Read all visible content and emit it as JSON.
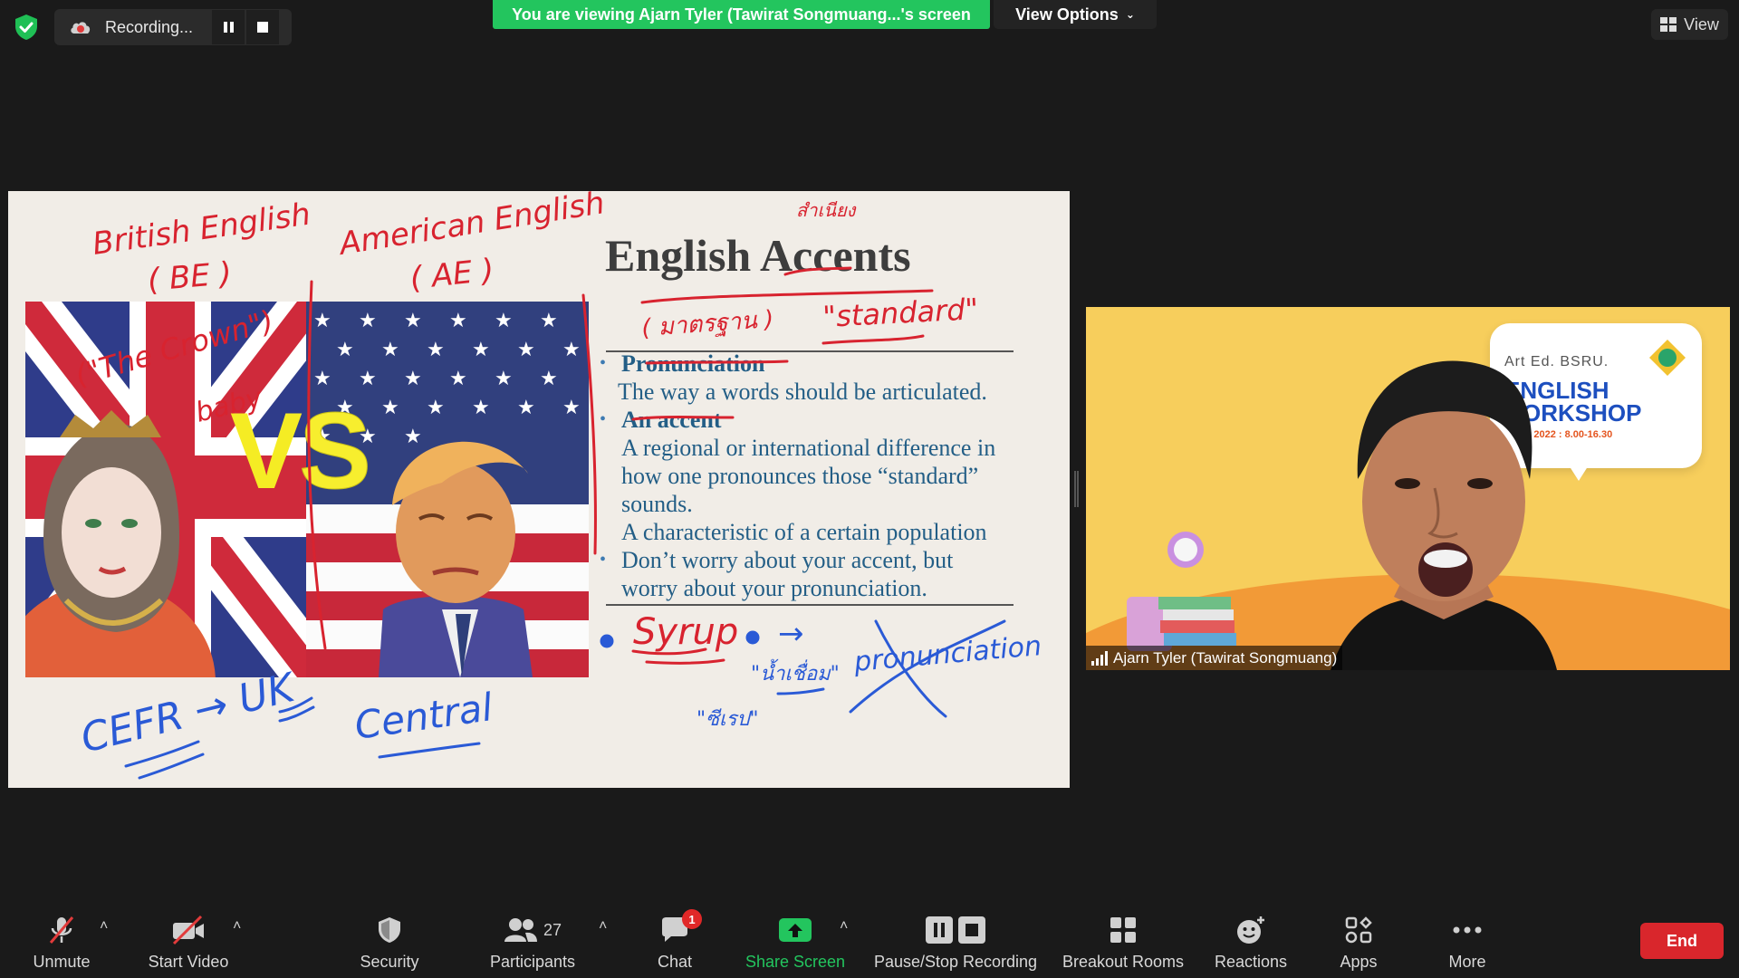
{
  "top_bar": {
    "recording_label": "Recording...",
    "viewing_banner": "You are viewing Ajarn Tyler (Tawirat Songmuang...'s screen",
    "view_options_label": "View Options",
    "view_label": "View",
    "icons": [
      "shield-check-icon",
      "cloud-record-icon",
      "pause-icon",
      "stop-icon",
      "grid-view-icon"
    ]
  },
  "slide": {
    "title": "English Accents",
    "bullets": [
      {
        "head": "Pronunciation",
        "lines": [
          "The way a words should be articulated."
        ]
      },
      {
        "head": "An accent",
        "lines": [
          "A regional or international difference in",
          "how one pronounces those “standard”",
          "sounds.",
          "A characteristic of a certain population"
        ]
      },
      {
        "head": "",
        "lines": [
          "Don’t worry about your accent, but",
          "worry about your pronunciation."
        ]
      }
    ],
    "vs_v": "V",
    "vs_s": "S",
    "annotations": {
      "british_english": "British English",
      "be": "( BE )",
      "american_english": "American English",
      "ae": "( AE )",
      "the_crown": "(\"The Crown\")",
      "baby": "baby",
      "thai_top": "สำเนียง",
      "thai_standard_pre": "( มาตรฐาน )",
      "standard": "\"standard\"",
      "syrup": "Syrup",
      "arrow": "→",
      "thai_syrup": "\"น้ำเชื่อม\"",
      "pronunciation_struck": "pronunciation",
      "thai_bottom": "\"ซีเรป\"",
      "cefr": "CEFR → UK",
      "central": "Central"
    },
    "ink_colors": {
      "red": "#d8232f",
      "blue": "#2a5ad6"
    }
  },
  "video": {
    "participant_name": "Ajarn Tyler (Tawirat Songmuang)",
    "background_banner": {
      "org": "Art Ed. BSRU.",
      "title_line1": "ENGLISH",
      "title_line2": "ORKSHOP",
      "date": "24, 2022 : 8.00-16.30"
    }
  },
  "toolbar": {
    "unmute": "Unmute",
    "start_video": "Start Video",
    "security": "Security",
    "participants": "Participants",
    "participant_count": "27",
    "chat": "Chat",
    "chat_badge": "1",
    "share_screen": "Share Screen",
    "pause_stop_recording": "Pause/Stop Recording",
    "breakout_rooms": "Breakout Rooms",
    "reactions": "Reactions",
    "apps": "Apps",
    "more": "More",
    "end": "End",
    "caret_glyph": "˄",
    "share_color": "#23c55e",
    "end_color": "#d9262c"
  }
}
